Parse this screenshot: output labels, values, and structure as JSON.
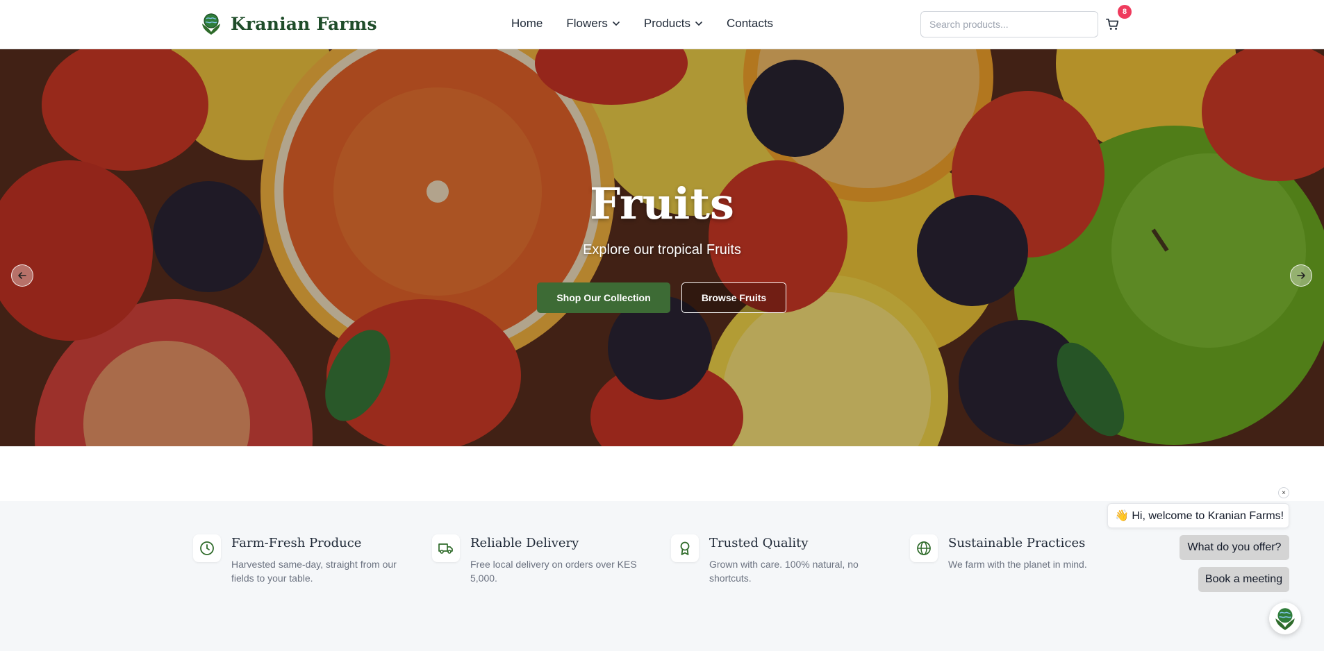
{
  "header": {
    "brand": "Kranian Farms",
    "nav": [
      {
        "label": "Home",
        "has_dropdown": false
      },
      {
        "label": "Flowers",
        "has_dropdown": true
      },
      {
        "label": "Products",
        "has_dropdown": true
      },
      {
        "label": "Contacts",
        "has_dropdown": false
      }
    ],
    "search_placeholder": "Search products...",
    "cart_count": "8",
    "brand_color": "#1f4d2a"
  },
  "hero": {
    "title": "Fruits",
    "subtitle": "Explore our tropical Fruits",
    "primary_button": "Shop Our Collection",
    "secondary_button": "Browse Fruits",
    "primary_color": "#3d6b35"
  },
  "features": [
    {
      "icon": "clock-icon",
      "title": "Farm-Fresh Produce",
      "desc": "Harvested same-day, straight from our fields to your table."
    },
    {
      "icon": "truck-icon",
      "title": "Reliable Delivery",
      "desc": "Free local delivery on orders over KES 5,000."
    },
    {
      "icon": "award-icon",
      "title": "Trusted Quality",
      "desc": "Grown with care. 100% natural, no shortcuts."
    },
    {
      "icon": "globe-icon",
      "title": "Sustainable Practices",
      "desc": "We farm with the planet in mind."
    }
  ],
  "chat": {
    "close": "×",
    "welcome": "👋 Hi, welcome to Kranian Farms!",
    "options": [
      "What do you offer?",
      "Book a meeting"
    ]
  }
}
